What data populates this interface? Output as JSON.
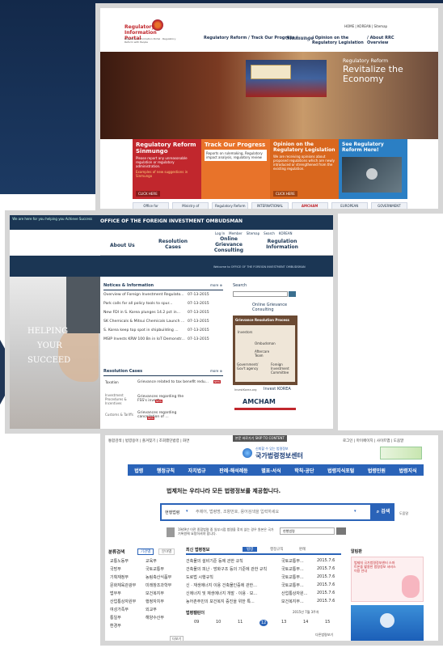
{
  "colors": {
    "navy": "#1b3654",
    "blue": "#2a63b8",
    "orange": "#e8732a",
    "red": "#c1272d",
    "brown": "#6b4a33"
  },
  "s1": {
    "logo_title": "Regulatory Information Portal",
    "logo_sub": "Regulatory Information Portal · Regulatory Reform with People",
    "util": "HOME | KOREAN | Sitemap",
    "nav": [
      "Regulatory Reform / Track Our Progress /",
      "Sinmungo",
      "/ Opinion on the Regulatory Legislation",
      "/ About RRC Overview"
    ],
    "hero_title": "Regulatory Reform",
    "hero_headline": "Revitalize the Economy",
    "tiles": [
      {
        "title": "Regulatory Reform Sinmungo",
        "body": "Please report any unreasonable regulation or regulatory administration.",
        "extra": "Examples of new suggestions in Sinmungo",
        "cta": "CLICK HERE",
        "color": "#c1272d"
      },
      {
        "title": "Track Our Progress",
        "body": "Reports on rulemaking, Regulatory impact analysis, regulatory review",
        "cta": "",
        "color": "#e8732a"
      },
      {
        "title": "Opinion on the Regulatory Legislation",
        "body": "We are receiving opinions about proposed regulations which are newly introduced or strengthened from the existing regulation.",
        "cta": "CLICK HERE",
        "color": "#d9671e"
      },
      {
        "title": "See Regulatory Reform Here!",
        "body": "",
        "cta": "",
        "color": "#2b7fc4"
      }
    ],
    "logos": [
      "Office for Government Policy Coordination",
      "Ministry of Government Legislation",
      "Regulatory Reform",
      "INTERNATIONAL CHAMBER OF COMMERCE",
      "AMCHAM",
      "EUROPEAN CHAMBER",
      "GOVERNMENT"
    ]
  },
  "s2": {
    "tagline": "We are here for you helping you Achieve Success",
    "office": "OFFICE OF THE FOREIGN INVESTMENT OMBUDSMAN",
    "top_links": [
      "Log In",
      "Member",
      "Sitemap",
      "Search",
      "KOREAN"
    ],
    "nav": [
      "About Us",
      "Resolution Cases",
      "Online Grievance Consulting",
      "Regulation Information"
    ],
    "welcome": "Welcome to OFFICE OF THE FOREIGN INVESTMENT OMBUDSMAN",
    "hero_text": [
      "HELPING",
      "YOUR",
      "SUCCEED"
    ],
    "notices_title": "Notices & Information",
    "more": "more ⊕",
    "notices": [
      {
        "text": "Overview of Foreign Investment Regulato...",
        "date": "07-13-2015"
      },
      {
        "text": "Park calls for all policy tools to spur...",
        "date": "07-13-2015"
      },
      {
        "text": "New FDI in S. Korea plunges 14.2 pct in...",
        "date": "07-13-2015"
      },
      {
        "text": "SK Chemicals & Mitsui Chemicals Launch ...",
        "date": "07-13-2015"
      },
      {
        "text": "S. Korea keep top spot in shipbuilding ...",
        "date": "07-13-2015"
      },
      {
        "text": "MSIP Invests KRW 100 Bn in IoT Demonstr...",
        "date": "07-13-2015"
      }
    ],
    "search_title": "Search",
    "online_grievance": "Online Grievance Consulting",
    "process_title": "Grievance Resolution Process",
    "process_labels": [
      "Investors",
      "Ombudsman",
      "Aftercare Team",
      "Government/ Gov't agency",
      "Foreign Investment Committee"
    ],
    "resolution_title": "Resolution Cases",
    "categories": [
      "Taxation",
      "Investment Procedures & Incentives",
      "Customs & Tariffs"
    ],
    "cases": [
      "Grievance related to tax benefit redu...",
      "Grievances regarding the FSS's invest...",
      "Grievances regarding cancellation of ..."
    ],
    "new_badge": "NEW",
    "partners": [
      "InvestKorea.org",
      "Invest KOREA"
    ],
    "amcham": "AMCHAM"
  },
  "s3": {
    "skip": "본문 바로가기 SKIP TO CONTENT",
    "top_left": "통합검색 | 법령용어 | 즐겨찾기 | 조회했던법령 | 화면",
    "top_right": "로그인 | 마이페이지 | 사이트맵 | 도움말",
    "logo_slogan": "신뢰할 수 있는 법령정보",
    "logo": "국가법령정보센터",
    "menu": [
      "법령",
      "행정규칙",
      "자치법규",
      "판례·해석례등",
      "별표·서식",
      "학칙·공단",
      "법령지식포털",
      "법령민원",
      "법령지식"
    ],
    "headline": "법제처는 우리나라 모든 법령정보를 제공합니다.",
    "scope": "현행법령",
    "placeholder": "주제어, 법령명, 조항번호, 용어검색을 입력하세요",
    "search_btn": "검색",
    "detail": "도움말",
    "notice_line": "1949년 이전 종합법령 중 일부시점 법령을 찾지 않는 경우 원본은 국가기록원에 요청하셔야 합니다.",
    "panel_title": "분류검색",
    "panel_tabs": [
      "기관별",
      "분야별"
    ],
    "agencies": [
      [
        "교통노동부",
        "교육부"
      ],
      [
        "국방부",
        "국토교통부"
      ],
      [
        "기획재정부",
        "농림축산식품부"
      ],
      [
        "문화체육관광부",
        "미래창조과학부"
      ],
      [
        "법무부",
        "보건복지부"
      ],
      [
        "산업통상자원부",
        "행정자치부"
      ],
      [
        "여성가족부",
        "외교부"
      ],
      [
        "통일부",
        "해양수산부"
      ],
      [
        "환경부",
        ""
      ]
    ],
    "more_btn": "더보기",
    "law_tabs": [
      "최신 법령정보",
      "법령",
      "행정규칙",
      "판례"
    ],
    "laws": [
      {
        "name": "건축물의 설비기준 등에 관한 규칙",
        "dept": "국토교통부...",
        "date": "2015.7.6"
      },
      {
        "name": "건축물의 피난 · 방화구조 등의 기준에 관한 규칙",
        "dept": "국토교통부...",
        "date": "2015.7.6"
      },
      {
        "name": "도로법 시행규칙",
        "dept": "국토교통부...",
        "date": "2015.7.6"
      },
      {
        "name": "신 · 재생에너지 이용 건축물인증에 관한...",
        "dept": "국토교통부...",
        "date": "2015.7.6"
      },
      {
        "name": "신에너지 및 재생에너지 개발 · 이용 · 보...",
        "dept": "산업통상자원...",
        "date": "2015.7.6"
      },
      {
        "name": "농어촌주민의 보건복지 증진을 위한 특...",
        "dept": "보건복지부...",
        "date": "2015.7.6"
      }
    ],
    "calendar_title": "법령캘린더",
    "calendar_month": "2015년 7월 3주차",
    "days": [
      "09",
      "10",
      "11",
      "12",
      "13",
      "14",
      "15"
    ],
    "side_title": "알림판",
    "side_text": "법제처 국가법령정보센터 스마트폰을 활용한 법령정보 서비스 이용 안내",
    "dasin": "다른법령보기"
  }
}
